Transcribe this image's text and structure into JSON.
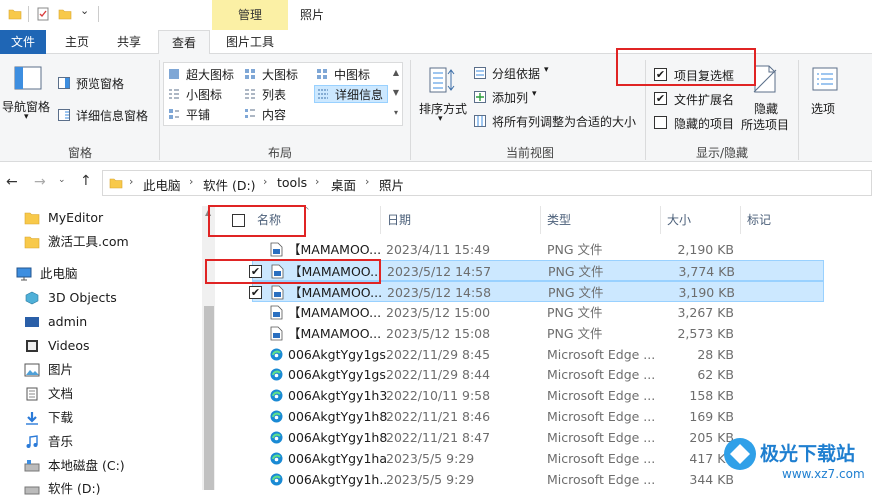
{
  "titlebar": {
    "manage_label": "管理",
    "window_title": "照片"
  },
  "tabs": [
    {
      "label": "文件",
      "active": false,
      "accent": true
    },
    {
      "label": "主页",
      "active": false
    },
    {
      "label": "共享",
      "active": false
    },
    {
      "label": "查看",
      "active": true
    },
    {
      "label": "图片工具",
      "active": false
    }
  ],
  "ribbon": {
    "pane_group": {
      "label": "窗格",
      "nav_pane": "导航窗格",
      "preview_pane": "预览窗格",
      "details_pane": "详细信息窗格"
    },
    "layout_group": {
      "label": "布局",
      "items": [
        "超大图标",
        "大图标",
        "中图标",
        "小图标",
        "列表",
        "详细信息",
        "平铺",
        "内容"
      ],
      "selected": "详细信息"
    },
    "current_view_group": {
      "label": "当前视图",
      "sort_by": "排序方式",
      "group_by": "分组依据",
      "add_column": "添加列",
      "fit_columns": "将所有列调整为合适的大小"
    },
    "show_hide_group": {
      "label": "显示/隐藏",
      "item_checkboxes": {
        "label": "项目复选框",
        "checked": true
      },
      "file_extensions": {
        "label": "文件扩展名",
        "checked": true
      },
      "hidden_items": {
        "label": "隐藏的项目",
        "checked": false
      },
      "hide_selected_line1": "隐藏",
      "hide_selected_line2": "所选项目"
    },
    "options_label": "选项"
  },
  "address": {
    "crumbs": [
      "此电脑",
      "软件 (D:)",
      "tools",
      "桌面",
      "照片"
    ]
  },
  "nav_pane": {
    "items": [
      {
        "label": "MyEditor",
        "icon": "folder-icon"
      },
      {
        "label": "激活工具.com",
        "icon": "folder-icon"
      },
      {
        "label": "此电脑",
        "icon": "computer-icon"
      },
      {
        "label": "3D Objects",
        "icon": "3d-objects-icon"
      },
      {
        "label": "admin",
        "icon": "user-folder-icon"
      },
      {
        "label": "Videos",
        "icon": "videos-icon"
      },
      {
        "label": "图片",
        "icon": "pictures-icon"
      },
      {
        "label": "文档",
        "icon": "documents-icon"
      },
      {
        "label": "下载",
        "icon": "download-icon"
      },
      {
        "label": "音乐",
        "icon": "music-icon"
      },
      {
        "label": "本地磁盘 (C:)",
        "icon": "drive-icon"
      },
      {
        "label": "软件 (D:)",
        "icon": "drive-icon"
      }
    ]
  },
  "columns": {
    "name": "名称",
    "date": "日期",
    "type": "类型",
    "size": "大小",
    "tags": "标记"
  },
  "files": [
    {
      "name": "【MAMAMOO...",
      "date": "2023/4/11 15:49",
      "type": "PNG 文件",
      "size": "2,190 KB",
      "icon": "png-file-icon",
      "selected": false,
      "checked": false
    },
    {
      "name": "【MAMAMOO...",
      "date": "2023/5/12 14:57",
      "type": "PNG 文件",
      "size": "3,774 KB",
      "icon": "png-file-icon",
      "selected": true,
      "checked": true
    },
    {
      "name": "【MAMAMOO...",
      "date": "2023/5/12 14:58",
      "type": "PNG 文件",
      "size": "3,190 KB",
      "icon": "png-file-icon",
      "selected": true,
      "checked": true
    },
    {
      "name": "【MAMAMOO...",
      "date": "2023/5/12 15:00",
      "type": "PNG 文件",
      "size": "3,267 KB",
      "icon": "png-file-icon",
      "selected": false,
      "checked": false
    },
    {
      "name": "【MAMAMOO...",
      "date": "2023/5/12 15:08",
      "type": "PNG 文件",
      "size": "2,573 KB",
      "icon": "png-file-icon",
      "selected": false,
      "checked": false
    },
    {
      "name": "006AkgtYgy1gs...",
      "date": "2022/11/29 8:45",
      "type": "Microsoft Edge ...",
      "size": "28 KB",
      "icon": "edge-icon",
      "selected": false,
      "checked": false
    },
    {
      "name": "006AkgtYgy1gs...",
      "date": "2022/11/29 8:44",
      "type": "Microsoft Edge ...",
      "size": "62 KB",
      "icon": "edge-icon",
      "selected": false,
      "checked": false
    },
    {
      "name": "006AkgtYgy1h3...",
      "date": "2022/10/11 9:58",
      "type": "Microsoft Edge ...",
      "size": "158 KB",
      "icon": "edge-icon",
      "selected": false,
      "checked": false
    },
    {
      "name": "006AkgtYgy1h8...",
      "date": "2022/11/21 8:46",
      "type": "Microsoft Edge ...",
      "size": "169 KB",
      "icon": "edge-icon",
      "selected": false,
      "checked": false
    },
    {
      "name": "006AkgtYgy1h8...",
      "date": "2022/11/21 8:47",
      "type": "Microsoft Edge ...",
      "size": "205 KB",
      "icon": "edge-icon",
      "selected": false,
      "checked": false
    },
    {
      "name": "006AkgtYgy1ha...",
      "date": "2023/5/5 9:29",
      "type": "Microsoft Edge ...",
      "size": "417 KB",
      "icon": "edge-icon",
      "selected": false,
      "checked": false
    },
    {
      "name": "006AkgtYgy1h...",
      "date": "2023/5/5 9:29",
      "type": "Microsoft Edge ...",
      "size": "344 KB",
      "icon": "edge-icon",
      "selected": false,
      "checked": false
    }
  ],
  "colors": {
    "file_tab": "#1f66b5",
    "manage_tab": "#fbf0a5",
    "selection": "#cce8ff",
    "highlight_box": "#e02424"
  }
}
